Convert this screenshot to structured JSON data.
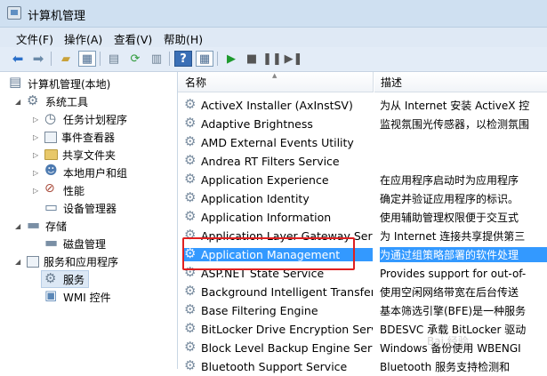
{
  "window": {
    "title": "计算机管理"
  },
  "menu": {
    "file": "文件(F)",
    "action": "操作(A)",
    "view": "查看(V)",
    "help": "帮助(H)"
  },
  "toolbar": {
    "icons": [
      "back-icon",
      "forward-icon",
      "up-icon",
      "show-hide-tree-icon",
      "properties-icon",
      "refresh-icon",
      "export-icon",
      "help-icon",
      "view-icon",
      "start-icon",
      "stop-icon",
      "pause-icon",
      "restart-icon"
    ]
  },
  "tree": {
    "root": "计算机管理(本地)",
    "system_tools": "系统工具",
    "task_scheduler": "任务计划程序",
    "event_viewer": "事件查看器",
    "shared_folders": "共享文件夹",
    "local_users": "本地用户和组",
    "performance": "性能",
    "device_manager": "设备管理器",
    "storage": "存储",
    "disk_management": "磁盘管理",
    "services_apps": "服务和应用程序",
    "services": "服务",
    "wmi": "WMI 控件"
  },
  "columns": {
    "name": "名称",
    "description": "描述"
  },
  "services": [
    {
      "name": "ActiveX Installer (AxInstSV)",
      "desc": "为从 Internet 安装 ActiveX 控"
    },
    {
      "name": "Adaptive Brightness",
      "desc": "监视氛围光传感器，以检测氛围"
    },
    {
      "name": "AMD External Events Utility",
      "desc": ""
    },
    {
      "name": "Andrea RT Filters Service",
      "desc": ""
    },
    {
      "name": "Application Experience",
      "desc": "在应用程序启动时为应用程序"
    },
    {
      "name": "Application Identity",
      "desc": "确定并验证应用程序的标识。"
    },
    {
      "name": "Application Information",
      "desc": "使用辅助管理权限便于交互式"
    },
    {
      "name": "Application Layer Gateway Servi",
      "desc": "为 Internet 连接共享提供第三"
    },
    {
      "name": "Application Management",
      "desc": "为通过组策略部署的软件处理"
    },
    {
      "name": "ASP.NET State Service",
      "desc": "Provides support for out-of-"
    },
    {
      "name": "Background Intelligent Transfer",
      "desc": "使用空闲网络带宽在后台传送"
    },
    {
      "name": "Base Filtering Engine",
      "desc": "基本筛选引擎(BFE)是一种服务"
    },
    {
      "name": "BitLocker Drive Encryption Servi",
      "desc": "BDESVC 承载 BitLocker 驱动"
    },
    {
      "name": "Block Level Backup Engine Serv",
      "desc": "Windows 备份使用 WBENGI"
    },
    {
      "name": "Bluetooth Support Service",
      "desc": "Bluetooth 服务支持检测和"
    }
  ],
  "selected_index": 8,
  "colors": {
    "selection": "#3399ff",
    "highlight_box": "#e02020"
  },
  "watermark": "Bai 经验"
}
